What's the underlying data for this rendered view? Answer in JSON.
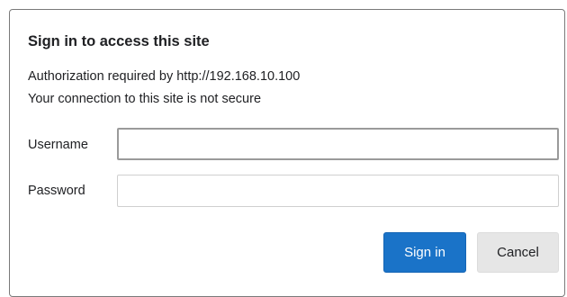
{
  "dialog": {
    "title": "Sign in to access this site",
    "auth_message": "Authorization required by http://192.168.10.100",
    "security_warning": "Your connection to this site is not secure",
    "username": {
      "label": "Username",
      "value": ""
    },
    "password": {
      "label": "Password",
      "value": ""
    },
    "buttons": {
      "sign_in": "Sign in",
      "cancel": "Cancel"
    }
  },
  "colors": {
    "primary_button": "#1a73c8",
    "secondary_button": "#e6e6e6",
    "text": "#202124"
  }
}
